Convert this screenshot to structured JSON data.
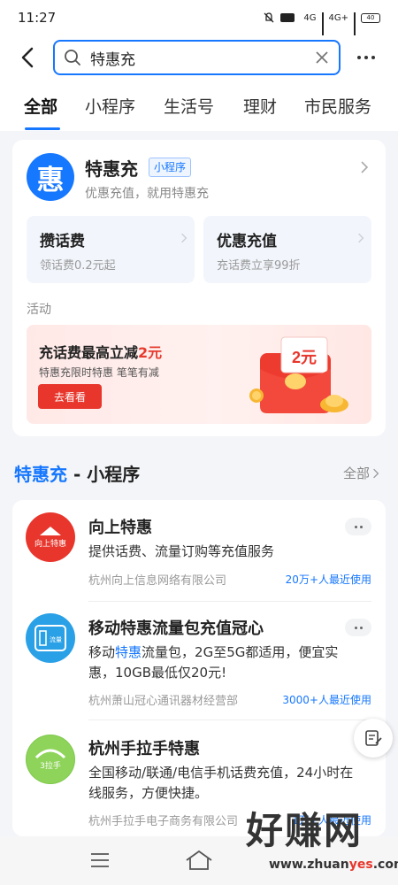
{
  "status_bar": {
    "time": "11:27",
    "battery": "40",
    "net1": "4G",
    "net2": "4G+"
  },
  "search": {
    "query": "特惠充"
  },
  "tabs": [
    {
      "label": "全部",
      "active": true
    },
    {
      "label": "小程序",
      "active": false
    },
    {
      "label": "生活号",
      "active": false
    },
    {
      "label": "理财",
      "active": false
    },
    {
      "label": "市民服务",
      "active": false
    }
  ],
  "app_card": {
    "logo_char": "惠",
    "name": "特惠充",
    "badge": "小程序",
    "desc": "优惠充值，就用特惠充",
    "services": [
      {
        "title": "攒话费",
        "sub": "领话费0.2元起"
      },
      {
        "title": "优惠充值",
        "sub": "充话费立享99折"
      }
    ],
    "activity_label": "活动",
    "promo": {
      "title_prefix": "充话费最高立减",
      "title_amount": "2元",
      "sub": "特惠充限时特惠  笔笔有减",
      "button": "去看看",
      "coupon_text": "2元"
    }
  },
  "mini_programs": {
    "title_keyword": "特惠充",
    "title_suffix": " - 小程序",
    "all_label": "全部",
    "items": [
      {
        "logo_text": "向上特惠",
        "name": "向上特惠",
        "desc": "提供话费、流量订购等充值服务",
        "org": "杭州向上信息网络有限公司",
        "users": "20万+人最近使用"
      },
      {
        "logo_text": "流量",
        "name": "移动特惠流量包充值冠心",
        "desc_before": "移动",
        "desc_highlight": "特惠",
        "desc_after": "流量包，2G至5G都适用，便宜实惠，10GB最低仅20元!",
        "org": "杭州萧山冠心通讯器材经营部",
        "users": "3000+人最近使用"
      },
      {
        "logo_text": "3拉手",
        "name": "杭州手拉手特惠",
        "desc": "全国移动/联通/电信手机话费充值，24小时在线服务，方便快捷。",
        "org": "杭州手拉手电子商务有限公司",
        "users": "1万+人最近使用"
      }
    ]
  },
  "watermark": {
    "big": "好赚网",
    "url_prefix": "www.zhuan",
    "url_red": "yes",
    "url_suffix": ".com"
  },
  "colors": {
    "accent": "#1677ff",
    "red": "#e8362c"
  }
}
